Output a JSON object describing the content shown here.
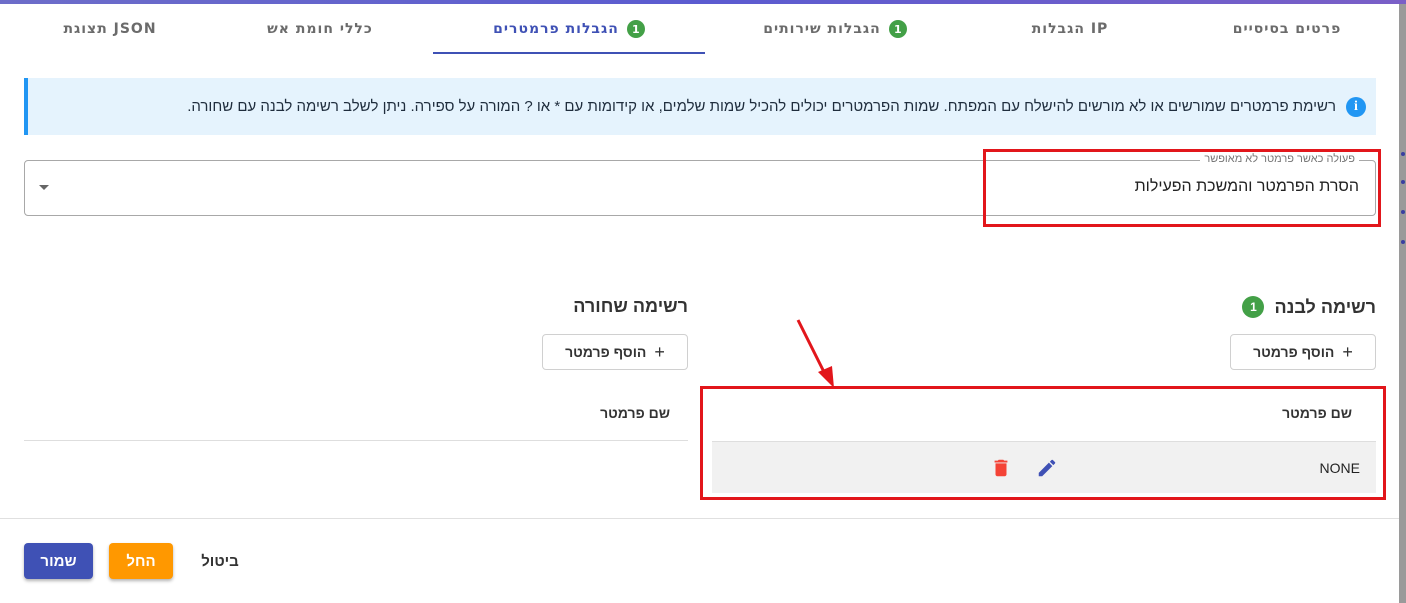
{
  "tabs": [
    {
      "label": "פרטים בסיסיים",
      "badge": "",
      "active": false
    },
    {
      "label": "הגבלות IP",
      "badge": "",
      "active": false
    },
    {
      "label": "הגבלות שירותים",
      "badge": "1",
      "active": false
    },
    {
      "label": "הגבלות פרמטרים",
      "badge": "1",
      "active": true
    },
    {
      "label": "כללי חומת אש",
      "badge": "",
      "active": false
    },
    {
      "label": "תצוגת JSON",
      "badge": "",
      "active": false
    }
  ],
  "info": {
    "icon": "info-icon",
    "text": "רשימת פרמטרים שמורשים או לא מורשים להישלח עם המפתח. שמות הפרמטרים יכולים להכיל שמות שלמים, או קידומות עם * או ? המורה על ספירה. ניתן לשלב רשימה לבנה עם שחורה."
  },
  "action_select": {
    "label": "פעולה כאשר פרמטר לא מאופשר",
    "value": "הסרת הפרמטר והמשכת הפעילות"
  },
  "whitelist": {
    "title": "רשימה לבנה",
    "badge": "1",
    "add_label": "הוסף פרמטר",
    "column_header": "שם פרמטר",
    "rows": [
      {
        "value": "NONE"
      }
    ]
  },
  "blacklist": {
    "title": "רשימה שחורה",
    "add_label": "הוסף פרמטר",
    "column_header": "שם פרמטר",
    "rows": []
  },
  "footer": {
    "save_label": "שמור",
    "apply_label": "החל",
    "cancel_label": "ביטול"
  },
  "colors": {
    "primary": "#3f51b5",
    "success_badge": "#43a047",
    "apply": "#ff9800",
    "delete": "#f44336",
    "highlight": "#e2161b"
  }
}
